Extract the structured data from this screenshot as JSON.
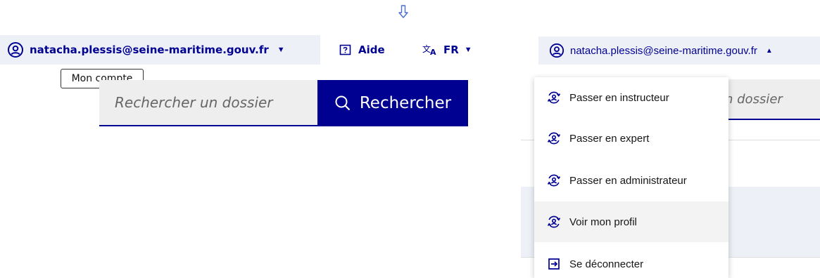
{
  "colors": {
    "primary": "#000091",
    "header_bg": "#eef0f8",
    "input_bg": "#eeeeee"
  },
  "left": {
    "account": {
      "email": "natacha.plessis@seine-maritime.gouv.fr",
      "icon": "account-circle-icon"
    },
    "help": {
      "label": "Aide",
      "icon": "question-square-icon"
    },
    "language": {
      "label": "FR",
      "icon": "translate-icon"
    },
    "tooltip": "Mon compte",
    "search": {
      "placeholder": "Rechercher un dossier",
      "button_label": "Rechercher",
      "icon": "search-icon"
    }
  },
  "right": {
    "account": {
      "email": "natacha.plessis@seine-maritime.gouv.fr",
      "icon": "account-circle-icon"
    },
    "search_partial_placeholder": "n dossier",
    "menu": [
      {
        "label": "Passer en instructeur",
        "icon": "switch-account-icon"
      },
      {
        "label": "Passer en expert",
        "icon": "switch-account-icon"
      },
      {
        "label": "Passer en administrateur",
        "icon": "switch-account-icon"
      },
      {
        "label": "Voir mon profil",
        "icon": "switch-account-icon"
      },
      {
        "label": "Se déconnecter",
        "icon": "logout-icon"
      }
    ]
  }
}
